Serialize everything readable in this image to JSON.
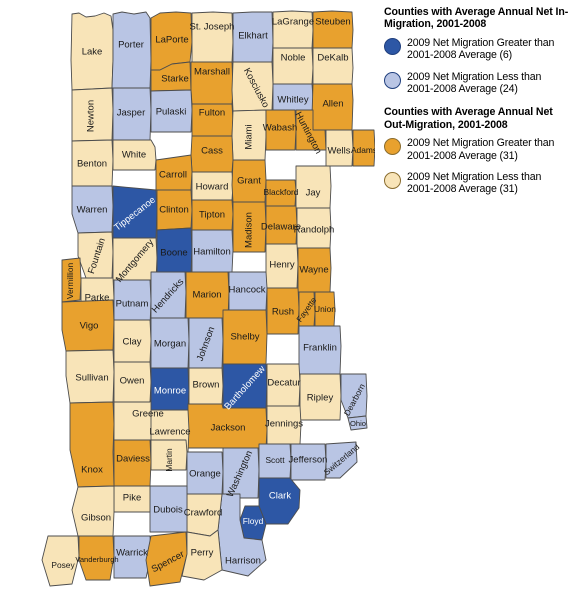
{
  "colors": {
    "in_greater": "#2d57a5",
    "in_less": "#b9c5e4",
    "out_greater": "#e8a12e",
    "out_less": "#f8e4b8",
    "border": "#4d4d4d",
    "background": "#ffffff"
  },
  "legend": {
    "blocks": [
      {
        "title": "Counties with Average Annual Net In-Migration, 2001-2008",
        "rows": [
          {
            "swatch": "in_greater",
            "text": "2009 Net Migration Greater than 2001-2008 Average (6)"
          },
          {
            "swatch": "in_less",
            "text": "2009 Net Migration Less than 2001-2008 Average (24)"
          }
        ]
      },
      {
        "title": "Counties with Average Annual Net Out-Migration, 2001-2008",
        "rows": [
          {
            "swatch": "out_greater",
            "text": "2009 Net Migration Greater than 2001-2008 Average (31)"
          },
          {
            "swatch": "out_less",
            "text": "2009 Net Migration Less than 2001-2008 Average (31)"
          }
        ]
      }
    ]
  },
  "map": {
    "state": "Indiana",
    "counties": [
      {
        "name": "Lake",
        "category": "out_less"
      },
      {
        "name": "Porter",
        "category": "in_less"
      },
      {
        "name": "LaPorte",
        "category": "out_greater"
      },
      {
        "name": "St. Joseph",
        "category": "out_less"
      },
      {
        "name": "Elkhart",
        "category": "in_less"
      },
      {
        "name": "LaGrange",
        "category": "out_less"
      },
      {
        "name": "Steuben",
        "category": "out_greater"
      },
      {
        "name": "Noble",
        "category": "out_less"
      },
      {
        "name": "DeKalb",
        "category": "out_less"
      },
      {
        "name": "Starke",
        "category": "out_greater"
      },
      {
        "name": "Marshall",
        "category": "out_greater"
      },
      {
        "name": "Kosciusko",
        "category": "out_less"
      },
      {
        "name": "Whitley",
        "category": "in_less"
      },
      {
        "name": "Allen",
        "category": "out_greater"
      },
      {
        "name": "Newton",
        "category": "out_less"
      },
      {
        "name": "Jasper",
        "category": "in_less"
      },
      {
        "name": "Pulaski",
        "category": "in_less"
      },
      {
        "name": "Fulton",
        "category": "out_greater"
      },
      {
        "name": "Miami",
        "category": "out_less"
      },
      {
        "name": "Wabash",
        "category": "out_greater"
      },
      {
        "name": "Huntington",
        "category": "out_greater"
      },
      {
        "name": "Wells",
        "category": "out_less"
      },
      {
        "name": "Adams",
        "category": "out_greater"
      },
      {
        "name": "Benton",
        "category": "out_less"
      },
      {
        "name": "White",
        "category": "out_less"
      },
      {
        "name": "Cass",
        "category": "out_greater"
      },
      {
        "name": "Carroll",
        "category": "out_greater"
      },
      {
        "name": "Howard",
        "category": "out_less"
      },
      {
        "name": "Grant",
        "category": "out_greater"
      },
      {
        "name": "Blackford",
        "category": "out_greater"
      },
      {
        "name": "Jay",
        "category": "out_less"
      },
      {
        "name": "Warren",
        "category": "in_less"
      },
      {
        "name": "Tippecanoe",
        "category": "in_greater"
      },
      {
        "name": "Clinton",
        "category": "out_greater"
      },
      {
        "name": "Tipton",
        "category": "out_greater"
      },
      {
        "name": "Madison",
        "category": "out_greater"
      },
      {
        "name": "Delaware",
        "category": "out_greater"
      },
      {
        "name": "Randolph",
        "category": "out_less"
      },
      {
        "name": "Fountain",
        "category": "out_less"
      },
      {
        "name": "Montgomery",
        "category": "out_less"
      },
      {
        "name": "Boone",
        "category": "in_greater"
      },
      {
        "name": "Hamilton",
        "category": "in_less"
      },
      {
        "name": "Henry",
        "category": "out_less"
      },
      {
        "name": "Wayne",
        "category": "out_greater"
      },
      {
        "name": "Vermillion",
        "category": "out_greater"
      },
      {
        "name": "Parke",
        "category": "out_less"
      },
      {
        "name": "Putnam",
        "category": "in_less"
      },
      {
        "name": "Hendricks",
        "category": "in_less"
      },
      {
        "name": "Marion",
        "category": "out_greater"
      },
      {
        "name": "Hancock",
        "category": "in_less"
      },
      {
        "name": "Rush",
        "category": "out_greater"
      },
      {
        "name": "Fayette",
        "category": "out_greater"
      },
      {
        "name": "Union",
        "category": "out_greater"
      },
      {
        "name": "Vigo",
        "category": "out_greater"
      },
      {
        "name": "Clay",
        "category": "out_less"
      },
      {
        "name": "Owen",
        "category": "out_less"
      },
      {
        "name": "Morgan",
        "category": "in_less"
      },
      {
        "name": "Johnson",
        "category": "in_less"
      },
      {
        "name": "Shelby",
        "category": "out_greater"
      },
      {
        "name": "Franklin",
        "category": "in_less"
      },
      {
        "name": "Sullivan",
        "category": "out_less"
      },
      {
        "name": "Greene",
        "category": "out_less"
      },
      {
        "name": "Monroe",
        "category": "in_greater"
      },
      {
        "name": "Brown",
        "category": "out_less"
      },
      {
        "name": "Bartholomew",
        "category": "in_greater"
      },
      {
        "name": "Decatur",
        "category": "out_less"
      },
      {
        "name": "Ripley",
        "category": "out_less"
      },
      {
        "name": "Dearborn",
        "category": "in_less"
      },
      {
        "name": "Ohio",
        "category": "in_less"
      },
      {
        "name": "Jennings",
        "category": "out_less"
      },
      {
        "name": "Jackson",
        "category": "out_greater"
      },
      {
        "name": "Lawrence",
        "category": "out_less"
      },
      {
        "name": "Martin",
        "category": "out_less"
      },
      {
        "name": "Daviess",
        "category": "out_greater"
      },
      {
        "name": "Knox",
        "category": "out_greater"
      },
      {
        "name": "Orange",
        "category": "in_less"
      },
      {
        "name": "Washington",
        "category": "in_less"
      },
      {
        "name": "Scott",
        "category": "in_less"
      },
      {
        "name": "Jefferson",
        "category": "in_less"
      },
      {
        "name": "Switzerland",
        "category": "in_less"
      },
      {
        "name": "Clark",
        "category": "in_greater"
      },
      {
        "name": "Floyd",
        "category": "in_greater"
      },
      {
        "name": "Harrison",
        "category": "in_less"
      },
      {
        "name": "Crawford",
        "category": "out_less"
      },
      {
        "name": "Dubois",
        "category": "in_less"
      },
      {
        "name": "Pike",
        "category": "out_less"
      },
      {
        "name": "Gibson",
        "category": "out_less"
      },
      {
        "name": "Posey",
        "category": "out_less"
      },
      {
        "name": "Vanderburgh",
        "category": "out_greater"
      },
      {
        "name": "Warrick",
        "category": "in_less"
      },
      {
        "name": "Spencer",
        "category": "out_greater"
      },
      {
        "name": "Perry",
        "category": "out_less"
      }
    ]
  }
}
